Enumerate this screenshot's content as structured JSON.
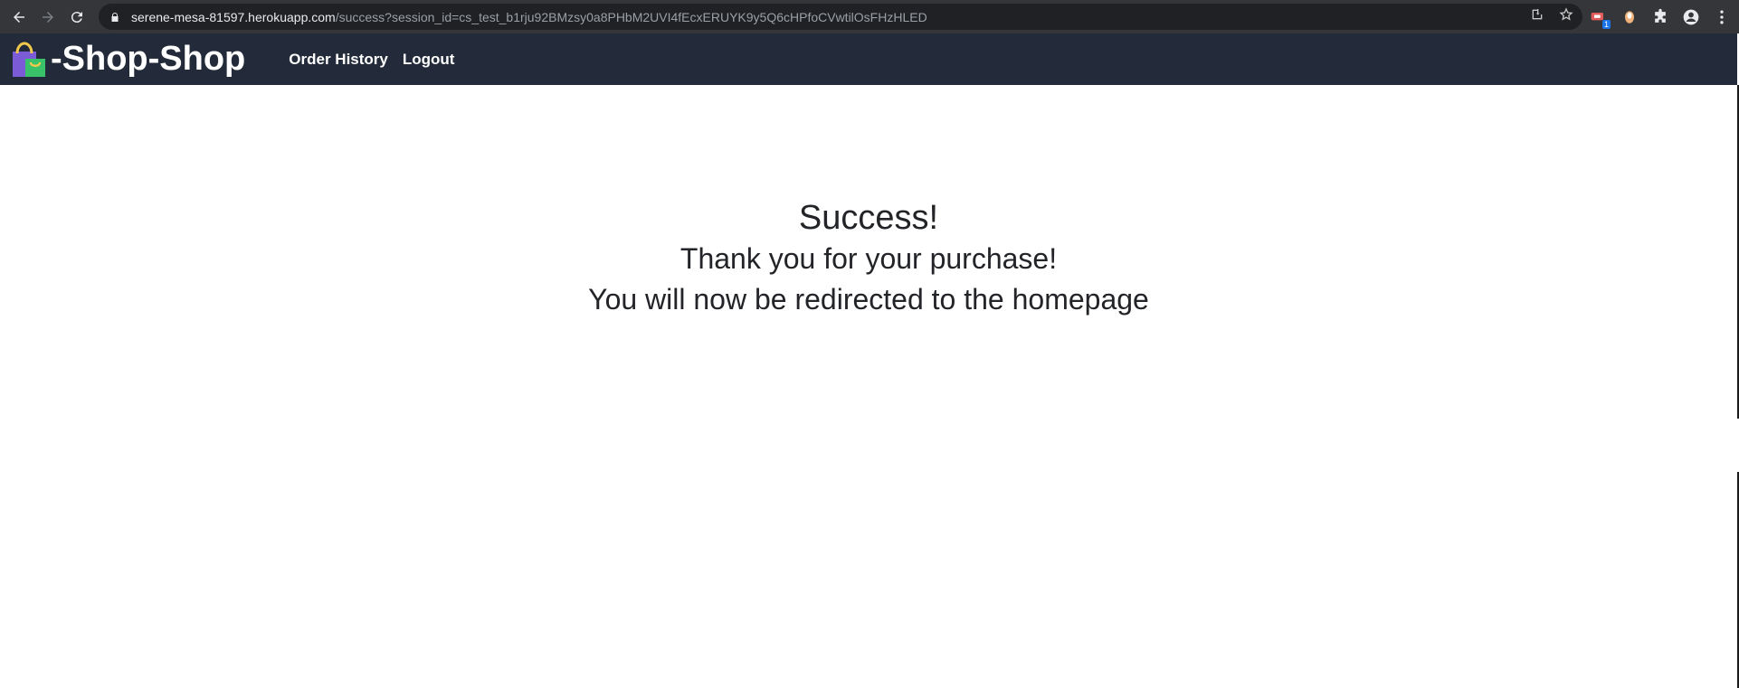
{
  "browser": {
    "url_host": "serene-mesa-81597.herokuapp.com",
    "url_path": "/success?session_id=cs_test_b1rju92BMzsy0a8PHbM2UVI4fEcxERUYK9y5Q6cHPfoCVwtilOsFHzHLED",
    "icons": [
      "back-icon",
      "forward-icon",
      "reload-icon",
      "lock-icon",
      "install-icon",
      "star-icon",
      "extension-icon",
      "puzzle-icon",
      "profile-icon",
      "menu-icon"
    ],
    "extension_badge": "1"
  },
  "header": {
    "brand": "-Shop-Shop",
    "brand_icon": "shopping-bag-icon",
    "links": [
      "Order History",
      "Logout"
    ],
    "background": "#232b3a"
  },
  "main": {
    "title": "Success!",
    "line1": "Thank you for your purchase!",
    "line2": "You will now be redirected to the homepage"
  }
}
